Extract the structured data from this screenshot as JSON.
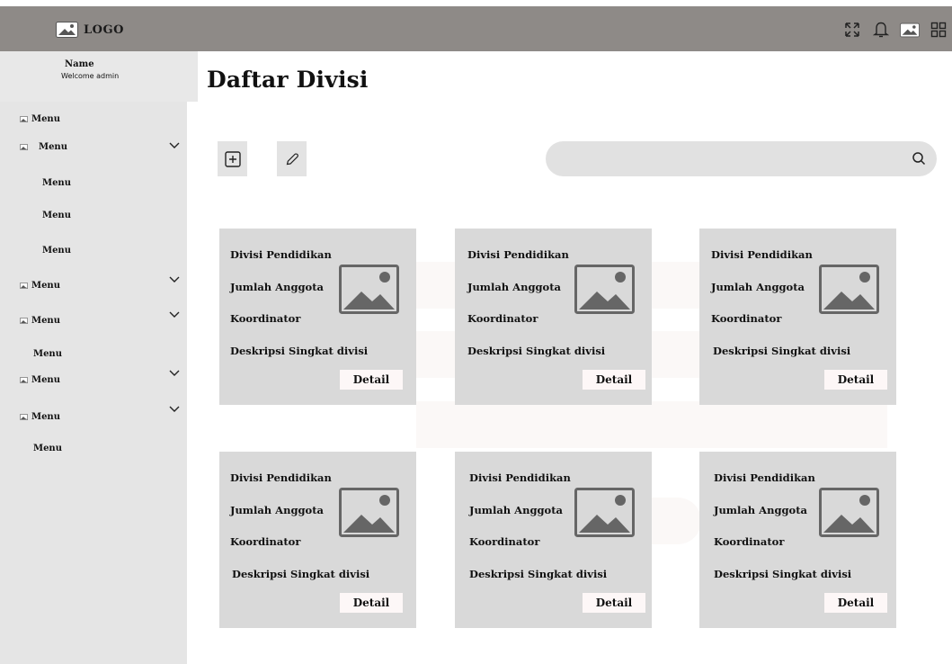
{
  "header": {
    "logo_text": "LOGO",
    "icons": [
      "expand-icon",
      "bell-icon",
      "image-icon",
      "grid-icon"
    ]
  },
  "sidebar": {
    "name": "Name",
    "welcome": "Welcome admin",
    "items": [
      {
        "label": "Menu",
        "icon": "image-icon",
        "chevron": false
      },
      {
        "label": "Menu",
        "icon": "image-icon",
        "chevron": true
      },
      {
        "label": "Menu",
        "icon": null,
        "chevron": false
      },
      {
        "label": "Menu",
        "icon": null,
        "chevron": false
      },
      {
        "label": "Menu",
        "icon": null,
        "chevron": false
      },
      {
        "label": "Menu",
        "icon": "image-icon",
        "chevron": true
      },
      {
        "label": "Menu",
        "icon": "image-icon",
        "chevron": true
      },
      {
        "label": "Menu",
        "icon": null,
        "chevron": false
      },
      {
        "label": "Menu",
        "icon": "image-icon",
        "chevron": true
      },
      {
        "label": "Menu",
        "icon": "image-icon",
        "chevron": true
      },
      {
        "label": "Menu",
        "icon": null,
        "chevron": false
      }
    ]
  },
  "main": {
    "title": "Daftar Divisi",
    "search": {
      "placeholder": ""
    },
    "cards": [
      {
        "name": "Divisi Pendidikan",
        "members": "Jumlah Anggota",
        "coordinator": "Koordinator",
        "description": "Deskripsi Singkat divisi",
        "button": "Detail"
      },
      {
        "name": "Divisi Pendidikan",
        "members": "Jumlah Anggota",
        "coordinator": "Koordinator",
        "description": "Deskripsi Singkat divisi",
        "button": "Detail"
      },
      {
        "name": "Divisi Pendidikan",
        "members": "Jumlah Anggota",
        "coordinator": "Koordinator",
        "description": "Deskripsi Singkat divisi",
        "button": "Detail"
      },
      {
        "name": "Divisi Pendidikan",
        "members": "Jumlah Anggota",
        "coordinator": "Koordinator",
        "description": "Deskripsi Singkat divisi",
        "button": "Detail"
      },
      {
        "name": "Divisi Pendidikan",
        "members": "Jumlah Anggota",
        "coordinator": "Koordinator",
        "description": "Deskripsi Singkat divisi",
        "button": "Detail"
      },
      {
        "name": "Divisi Pendidikan",
        "members": "Jumlah Anggota",
        "coordinator": "Koordinator",
        "description": "Deskripsi Singkat divisi",
        "button": "Detail"
      }
    ]
  },
  "colors": {
    "topbar": "#8e8a87",
    "sidebar": "#e5e5e5",
    "card": "#d9d9d9",
    "detail_button": "#fdf7f7",
    "placeholder_image": "#6b6b6b"
  }
}
